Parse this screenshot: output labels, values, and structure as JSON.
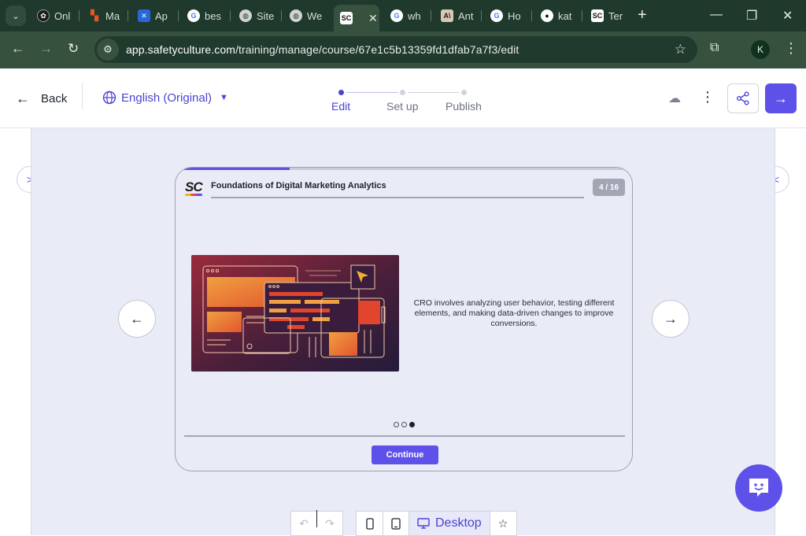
{
  "browser": {
    "tabs": [
      {
        "label": "Onl",
        "icon": "globe-dark-icon"
      },
      {
        "label": "Ma",
        "icon": "make-icon"
      },
      {
        "label": "Ap",
        "icon": "butterfly-icon"
      },
      {
        "label": "bes",
        "icon": "google-icon"
      },
      {
        "label": "Site",
        "icon": "globe-icon"
      },
      {
        "label": "We",
        "icon": "globe-icon"
      },
      {
        "label": "SC",
        "icon": "safetyculture-icon"
      },
      {
        "label": "wh",
        "icon": "google-icon"
      },
      {
        "label": "Ant",
        "icon": "anthropic-icon"
      },
      {
        "label": "Ho",
        "icon": "google-icon"
      },
      {
        "label": "kat",
        "icon": "github-icon"
      },
      {
        "label": "Ter",
        "icon": "safetyculture-icon"
      }
    ],
    "url_host": "app.safetyculture.com",
    "url_path": "/training/manage/course/67e1c5b13359fd1dfab7a7f3/edit",
    "profile_initial": "K"
  },
  "header": {
    "back_label": "Back",
    "language_label": "English (Original)",
    "steps": [
      "Edit",
      "Set up",
      "Publish"
    ],
    "active_step": 0
  },
  "slide": {
    "logo_text": "SC",
    "course_title": "Foundations of Digital Marketing Analytics",
    "page_indicator": "4 / 16",
    "progress": 0.25,
    "body_text": "CRO involves analyzing user behavior, testing different elements, and making data-driven changes to improve conversions.",
    "dots_total": 3,
    "dots_active": 2,
    "continue_label": "Continue"
  },
  "toolbar": {
    "desktop_label": "Desktop"
  },
  "colors": {
    "accent": "#5e51ea",
    "canvas_bg": "#e9ebf6",
    "chrome_dark": "#1f3a2c"
  }
}
